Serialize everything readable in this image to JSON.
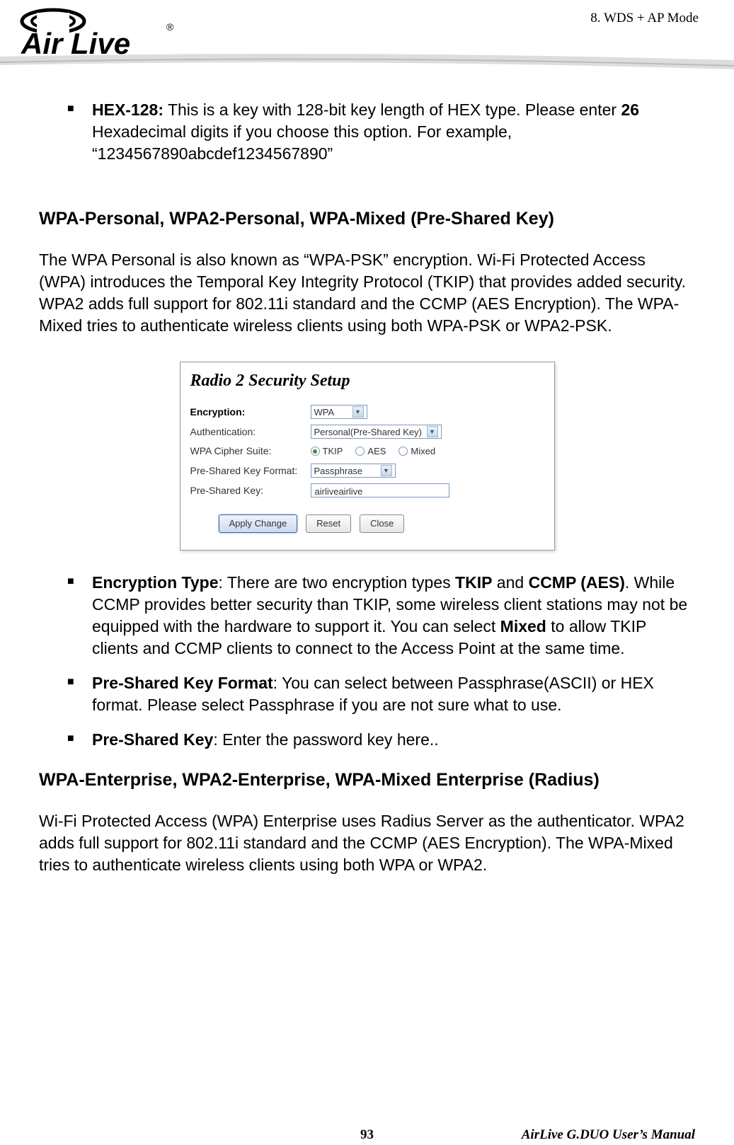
{
  "header": {
    "section_label": "8.  WDS  +  AP  Mode",
    "logo_text": "AirLive"
  },
  "hex128": {
    "label": "HEX-128:",
    "text1": " This is a key with 128-bit key length of HEX type.    Please enter ",
    "bold1": "26",
    "text2": " Hexadecimal digits if you choose this option. For example, “1234567890abcdef1234567890”"
  },
  "wpa_personal": {
    "heading": "WPA-Personal, WPA2-Personal, WPA-Mixed (Pre-Shared Key)",
    "para": "The WPA Personal is also known as “WPA-PSK” encryption.    Wi-Fi Protected Access (WPA) introduces the Temporal Key Integrity Protocol (TKIP) that provides added security.    WPA2 adds full support for 802.11i standard and the CCMP (AES Encryption).    The WPA-Mixed tries to authenticate wireless clients using both WPA-PSK or WPA2-PSK."
  },
  "screenshot": {
    "title": "Radio 2 Security Setup",
    "encryption_label": "Encryption:",
    "encryption_value": "WPA",
    "auth_label": "Authentication:",
    "auth_value": "Personal(Pre-Shared Key)",
    "cipher_label": "WPA Cipher Suite:",
    "cipher_tkip": "TKIP",
    "cipher_aes": "AES",
    "cipher_mixed": "Mixed",
    "psk_format_label": "Pre-Shared Key Format:",
    "psk_format_value": "Passphrase",
    "psk_label": "Pre-Shared Key:",
    "psk_value": "airliveairlive",
    "btn_apply": "Apply Change",
    "btn_reset": "Reset",
    "btn_close": "Close"
  },
  "bullets": {
    "enc_type_label": "Encryption Type",
    "enc_type_text": ":   There are two encryption types ",
    "enc_type_b1": "TKIP",
    "enc_type_mid": " and ",
    "enc_type_b2": "CCMP (AES)",
    "enc_type_text2": ". While CCMP provides better security than TKIP, some wireless client stations may not be equipped with the hardware to support it. You can select ",
    "enc_type_b3": "Mixed",
    "enc_type_text3": " to allow TKIP clients and CCMP clients to connect to the Access Point at the same time.",
    "pskf_label": "Pre-Shared Key Format",
    "pskf_text": ":    You can select between Passphrase(ASCII) or HEX format.    Please select Passphrase if you are not sure what to use.",
    "psk_label": "Pre-Shared Key",
    "psk_text": ":    Enter the password key here.."
  },
  "wpa_enterprise": {
    "heading": "WPA-Enterprise, WPA2-Enterprise, WPA-Mixed Enterprise (Radius)",
    "para": "Wi-Fi Protected Access (WPA) Enterprise uses Radius Server as the authenticator.    WPA2 adds full support for 802.11i standard and the CCMP (AES Encryption).    The WPA-Mixed tries to authenticate wireless clients using both WPA or WPA2."
  },
  "footer": {
    "page": "93",
    "manual": "AirLive  G.DUO  User’s  Manual"
  }
}
